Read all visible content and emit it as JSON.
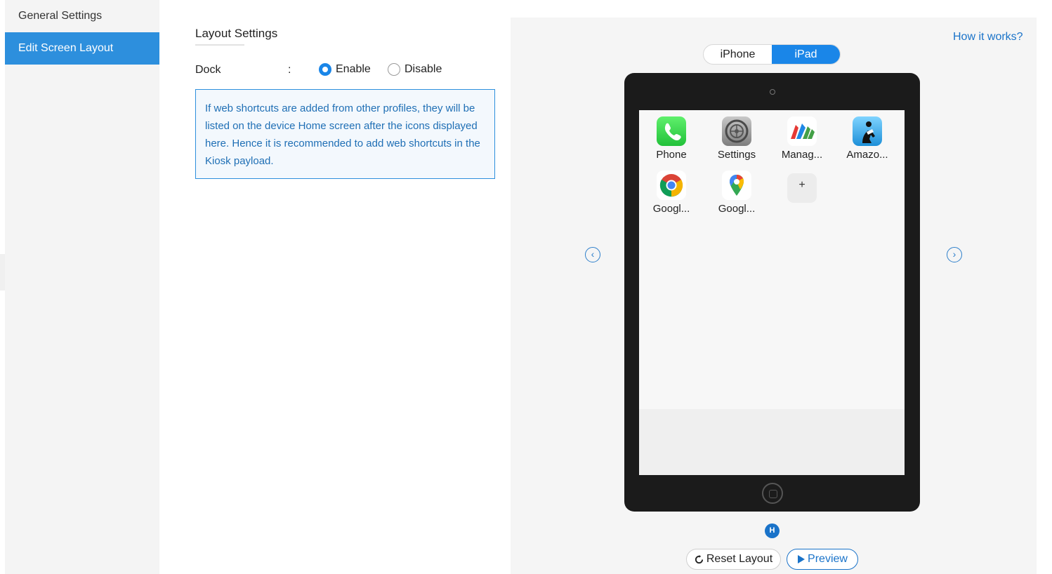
{
  "sidebar": {
    "items": [
      {
        "label": "General Settings"
      },
      {
        "label": "Edit Screen Layout"
      }
    ]
  },
  "settings": {
    "title": "Layout Settings",
    "dock_label": "Dock",
    "colon": ":",
    "enable_label": "Enable",
    "disable_label": "Disable",
    "selected": "Enable",
    "info": "If web shortcuts are added from other profiles, they will be listed on the device Home screen after the icons displayed here. Hence it is recommended to add web shortcuts in the Kiosk payload."
  },
  "preview": {
    "how_link": "How it works?",
    "toggle": [
      "iPhone",
      "iPad"
    ],
    "active_device": "iPad",
    "apps": [
      {
        "label": "Phone",
        "icon": "phone-icon"
      },
      {
        "label": "Settings",
        "icon": "settings-gear-icon"
      },
      {
        "label": "Manag...",
        "icon": "manageengine-icon"
      },
      {
        "label": "Amazo...",
        "icon": "kindle-icon"
      },
      {
        "label": "Googl...",
        "icon": "chrome-icon"
      },
      {
        "label": "Googl...",
        "icon": "google-maps-icon"
      }
    ],
    "add_symbol": "+",
    "prev_arrow": "‹",
    "next_arrow": "›",
    "page_indicator": "H",
    "reset_label": "Reset Layout",
    "preview_label": "Preview"
  },
  "colors": {
    "accent": "#1a86e8",
    "sidebar_active": "#2d8fdd",
    "ipad_frame": "#1b1b1b",
    "info_text": "#1f6fb5"
  }
}
